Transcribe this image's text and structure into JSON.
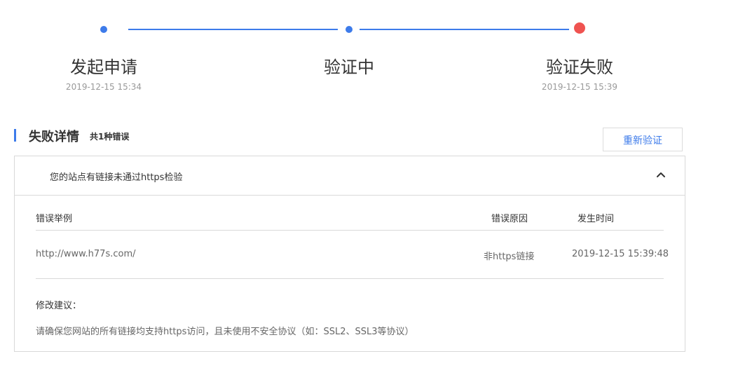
{
  "steps": [
    {
      "title": "发起申请",
      "time": "2019-12-15 15:34",
      "status": "done"
    },
    {
      "title": "验证中",
      "time": "",
      "status": "done"
    },
    {
      "title": "验证失败",
      "time": "2019-12-15 15:39",
      "status": "failed"
    }
  ],
  "colors": {
    "accent": "#3d7bea",
    "error": "#ef5350"
  },
  "section": {
    "title": "失败详情",
    "count_text": "共1种错误"
  },
  "retry_button": "重新验证",
  "panel": {
    "header": "您的站点有链接未通过https检验",
    "collapse_icon": "chevron-up-icon",
    "table": {
      "columns": [
        "错误举例",
        "错误原因",
        "发生时间"
      ],
      "rows": [
        [
          "http://www.h77s.com/",
          "非https链接",
          "2019-12-15 15:39:48"
        ]
      ]
    },
    "suggestion_label": "修改建议：",
    "suggestion_text": "请确保您网站的所有链接均支持https访问，且未使用不安全协议（如：SSL2、SSL3等协议）"
  }
}
